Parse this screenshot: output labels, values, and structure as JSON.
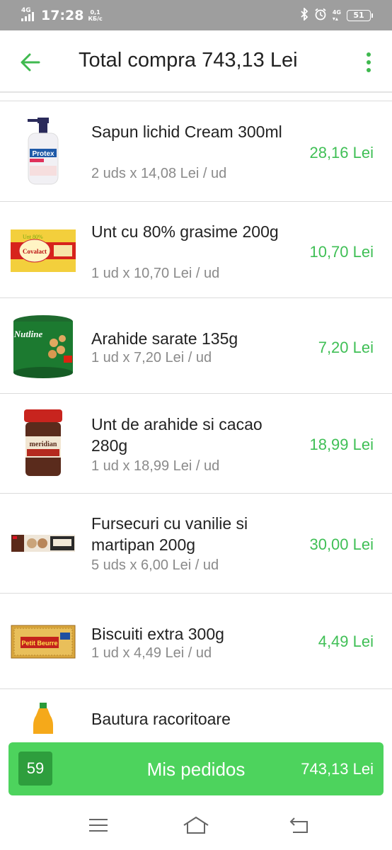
{
  "status_bar": {
    "network_label": "4G",
    "time": "17:28",
    "speed_value": "0,1",
    "speed_unit": "КБ/с",
    "net_right": "4G",
    "battery": "51",
    "icons": [
      "bluetooth-icon",
      "alarm-icon",
      "wifi-data-icon",
      "battery-icon"
    ]
  },
  "app_bar": {
    "title": "Total compra 743,13 Lei",
    "back_icon": "arrow-left-icon",
    "menu_icon": "more-vertical-icon"
  },
  "colors": {
    "accent": "#3fbf55",
    "button": "#4dd35d",
    "badge": "#2e9e3d",
    "status_bar": "#9e9e9e"
  },
  "items": [
    {
      "name": "Sapun lichid Cream 300ml",
      "qty": "2 uds x 14,08 Lei / ud",
      "price": "28,16 Lei",
      "image": "liquid-soap-image",
      "brand_text": "Protex"
    },
    {
      "name": "Unt cu 80% grasime 200g",
      "qty": "1 ud x 10,70 Lei / ud",
      "price": "10,70 Lei",
      "image": "butter-image",
      "brand_text": "Covalact"
    },
    {
      "name": "Arahide sarate 135g",
      "qty": "1 ud x 7,20 Lei / ud",
      "price": "7,20 Lei",
      "image": "peanuts-can-image",
      "brand_text": "Nutline"
    },
    {
      "name": "Unt de arahide si cacao 280g",
      "qty": "1 ud x 18,99 Lei / ud",
      "price": "18,99 Lei",
      "image": "peanut-butter-jar-image",
      "brand_text": "meridian"
    },
    {
      "name": "Fursecuri cu vanilie si martipan 200g",
      "qty": "5 uds x 6,00 Lei / ud",
      "price": "30,00 Lei",
      "image": "cookies-pack-image",
      "brand_text": ""
    },
    {
      "name": "Biscuiti extra  300g",
      "qty": "1 ud x 4,49 Lei / ud",
      "price": "4,49 Lei",
      "image": "biscuits-pack-image",
      "brand_text": "Petit Beurre"
    },
    {
      "name": "Bautura racoritoare",
      "qty": "",
      "price": "",
      "image": "soft-drink-bottle-image",
      "brand_text": ""
    }
  ],
  "footer": {
    "count": "59",
    "label": "Mis pedidos",
    "total": "743,13 Lei"
  },
  "nav_bar": {
    "icons": [
      "menu-icon",
      "home-icon",
      "back-icon"
    ]
  }
}
